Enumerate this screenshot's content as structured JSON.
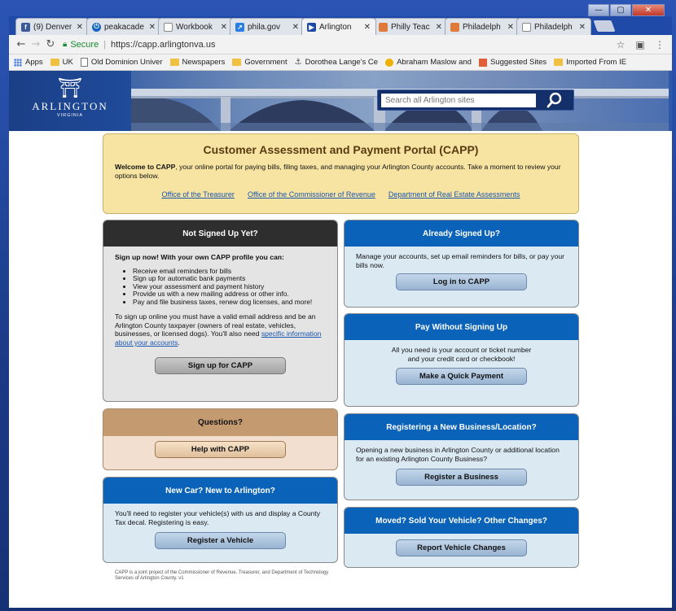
{
  "window": {
    "controls": [
      "—",
      "▢",
      "✕"
    ]
  },
  "tabs": [
    {
      "label": "(9) Denver",
      "icon": "facebook-icon",
      "color": "#3b5998"
    },
    {
      "label": "peakacade",
      "icon": "power-icon",
      "color": "#1565c0"
    },
    {
      "label": "Workbook",
      "icon": "page-icon",
      "color": "#888888"
    },
    {
      "label": "phila.gov",
      "icon": "phila-icon",
      "color": "#2a7de1"
    },
    {
      "label": "Arlington",
      "icon": "arlington-icon",
      "color": "#1f4aa8",
      "active": true
    },
    {
      "label": "Philly Teac",
      "icon": "image-icon",
      "color": "#e07a3a"
    },
    {
      "label": "Philadelph",
      "icon": "image-icon",
      "color": "#e07a3a"
    },
    {
      "label": "Philadelph",
      "icon": "page-icon",
      "color": "#888888"
    }
  ],
  "address": {
    "secure_label": "Secure",
    "url": "https://capp.arlingtonva.us"
  },
  "bookmarks": [
    {
      "label": "Apps",
      "type": "grid"
    },
    {
      "label": "UK",
      "type": "folder"
    },
    {
      "label": "Old Dominion Univer",
      "type": "page"
    },
    {
      "label": "Newspapers",
      "type": "folder"
    },
    {
      "label": "Government",
      "type": "folder"
    },
    {
      "label": "Dorothea Lange's Ce",
      "type": "anchor"
    },
    {
      "label": "Abraham Maslow and",
      "type": "circle"
    },
    {
      "label": "Suggested Sites",
      "type": "square"
    },
    {
      "label": "Imported From IE",
      "type": "folder"
    }
  ],
  "header": {
    "logo_name": "ARLINGTON",
    "logo_sub": "VIRGINIA",
    "search_placeholder": "Search all Arlington sites"
  },
  "capp": {
    "title": "Customer Assessment and Payment Portal (CAPP)",
    "intro_bold": "Welcome to CAPP",
    "intro_rest": ", your online portal for paying bills, filing taxes, and managing your Arlington County accounts. Take a moment to review your options below.",
    "links": [
      "Office of the Treasurer",
      "Office of the Commissioner of Revenue",
      "Department of Real Estate Assessments"
    ]
  },
  "not_signed": {
    "title": "Not Signed Up Yet?",
    "lead": "Sign up now! With your own CAPP profile you can:",
    "items": [
      "Receive email reminders for bills",
      "Sign up for automatic bank payments",
      "View your assessment and payment history",
      "Provide us with a new mailing address or other info.",
      "Pay and file business taxes, renew dog licenses, and more!"
    ],
    "para": "To sign up online you must have a valid email address and be an Arlington County taxpayer (owners of real estate, vehicles, businesses, or licensed dogs). You'll also need",
    "para_link": "specific information about your accounts",
    "para_end": ".",
    "button": "Sign up for CAPP"
  },
  "questions": {
    "title": "Questions?",
    "button": "Help with CAPP"
  },
  "newcar": {
    "title": "New Car? New to Arlington?",
    "text": "You'll need to register your vehicle(s) with us and display a County Tax decal. Registering is easy.",
    "button": "Register a Vehicle"
  },
  "signed_up": {
    "title": "Already Signed Up?",
    "text": "Manage your accounts, set up email reminders for bills, or pay your bills now.",
    "button": "Log in to CAPP"
  },
  "paywithout": {
    "title": "Pay Without Signing Up",
    "text1": "All you need is your account or ticket number",
    "text2": "and your credit card or checkbook!",
    "button": "Make a Quick Payment"
  },
  "newbiz": {
    "title": "Registering a New Business/Location?",
    "text": "Opening a new business in Arlington County or additional location for an existing Arlington County Business?",
    "button": "Register a Business"
  },
  "moved": {
    "title": "Moved? Sold Your Vehicle? Other Changes?",
    "button": "Report Vehicle Changes"
  },
  "footer": "CAPP is a joint project of the Commissioner of Revenue, Treasurer, and Department of Technology Services of Arlington County. v1"
}
